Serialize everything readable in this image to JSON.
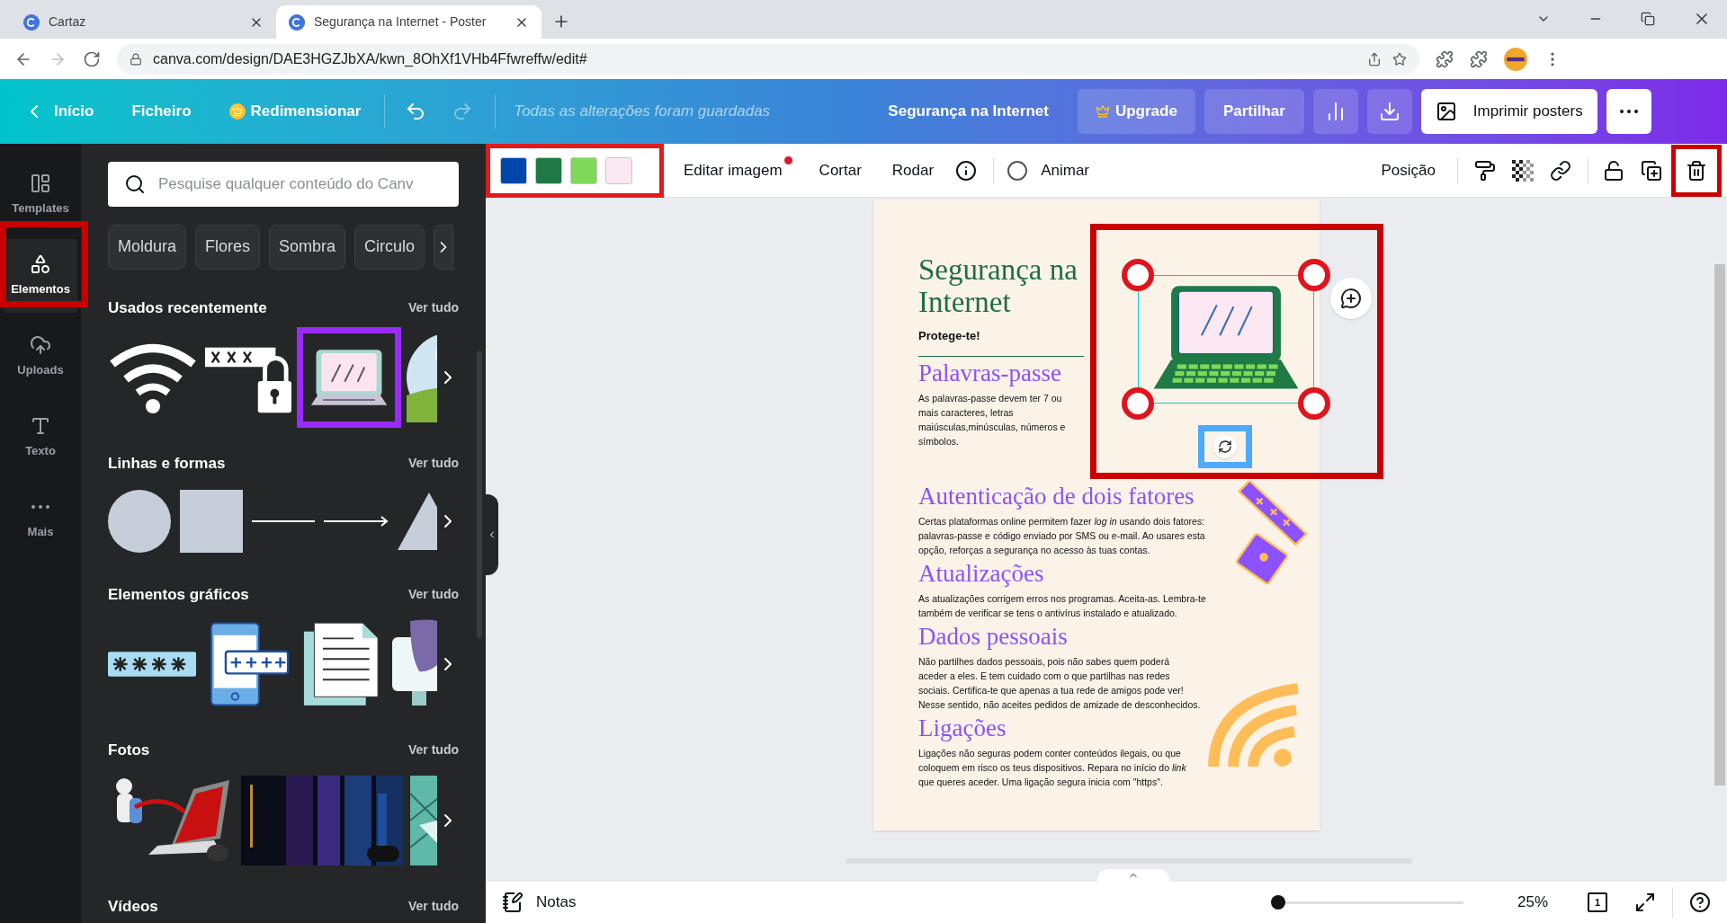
{
  "browser": {
    "tabs": [
      {
        "title": "Cartaz",
        "selected": false
      },
      {
        "title": "Segurança na Internet - Poster",
        "selected": true
      }
    ],
    "url": "canva.com/design/DAE3HGZJbXA/kwn_8OhXf1VHb4Ffwreffw/edit#"
  },
  "header": {
    "back": "Início",
    "file": "Ficheiro",
    "resize": "Redimensionar",
    "status": "Todas as alterações foram guardadas",
    "title": "Segurança na Internet",
    "upgrade": "Upgrade",
    "share": "Partilhar",
    "print": "Imprimir posters"
  },
  "rail": [
    {
      "label": "Templates",
      "selected": false
    },
    {
      "label": "Elementos",
      "selected": true
    },
    {
      "label": "Uploads",
      "selected": false
    },
    {
      "label": "Texto",
      "selected": false
    },
    {
      "label": "Mais",
      "selected": false
    }
  ],
  "panel": {
    "search": {
      "placeholder": "Pesquise qualquer conteúdo do Canv"
    },
    "chips": [
      "Moldura",
      "Flores",
      "Sombra",
      "Circulo"
    ],
    "sections": [
      {
        "title": "Usados recentemente",
        "link": "Ver tudo"
      },
      {
        "title": "Linhas e formas",
        "link": "Ver tudo"
      },
      {
        "title": "Elementos gráficos",
        "link": "Ver tudo"
      },
      {
        "title": "Fotos",
        "link": "Ver tudo"
      },
      {
        "title": "Vídeos",
        "link": "Ver tudo"
      }
    ]
  },
  "toolbar": {
    "colors": [
      {
        "color": "#0047ab"
      },
      {
        "color": "#1f7a45"
      },
      {
        "color": "#7ed957"
      },
      {
        "color": "#fce8f3"
      }
    ],
    "edit": "Editar imagem",
    "crop": "Cortar",
    "rotate": "Rodar",
    "animate": "Animar",
    "position": "Posição"
  },
  "poster": {
    "title": "Segurança na Internet",
    "subtitle": "Protege-te!",
    "sections": [
      {
        "heading": "Palavras-passe",
        "body": "As palavras-passe devem ter 7 ou mais caracteres, letras maiúsculas,minúsculas, números e símbolos."
      },
      {
        "heading": "Autenticação de dois fatores",
        "body": "Certas plataformas online permitem fazer *log in* usando dois fatores: palavras-passe e código enviado por SMS ou e-mail. Ao usares esta opção, reforças a segurança no acesso às tuas contas."
      },
      {
        "heading": "Atualizações",
        "body": "As atualizações corrigem erros nos programas. Aceita-as. Lembra-te também de verificar se tens o antivírus instalado e atualizado."
      },
      {
        "heading": "Dados pessoais",
        "body": "Não partilhes dados pessoais, pois não sabes quem poderá aceder a eles. E tem cuidado com o que partilhas nas redes sociais. Certifica-te que apenas a tua rede de amigos pode ver! Nesse sentido, não aceites pedidos de amizade de desconhecidos."
      },
      {
        "heading": "Ligações",
        "body": "Ligações não seguras podem conter conteúdos ilegais, ou que coloquem em risco os teus dispositivos. Repara no início do *link* que queres aceder. Uma ligação segura inicia com \"https\"."
      }
    ]
  },
  "footer": {
    "notes": "Notas",
    "zoom": {
      "level": 0.02
    },
    "zoom_reading": "25%",
    "page": "1"
  }
}
